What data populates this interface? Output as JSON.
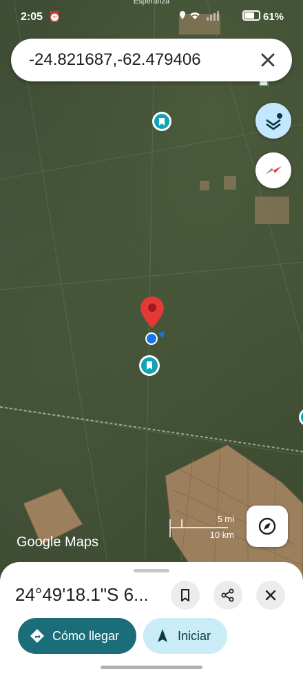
{
  "status_bar": {
    "time": "2:05",
    "place_label": "Esperanza",
    "battery": "61%"
  },
  "search": {
    "query": "-24.821687,-62.479406"
  },
  "map": {
    "logo": "Google Maps",
    "scale_mi": "5 mi",
    "scale_km": "10 km"
  },
  "sheet": {
    "title": "24°49'18.1\"S 6...",
    "directions_label": "Cómo llegar",
    "start_label": "Iniciar"
  },
  "colors": {
    "accent": "#1b6d7a",
    "pin": "#e53935",
    "location_dot": "#1a73e8"
  }
}
